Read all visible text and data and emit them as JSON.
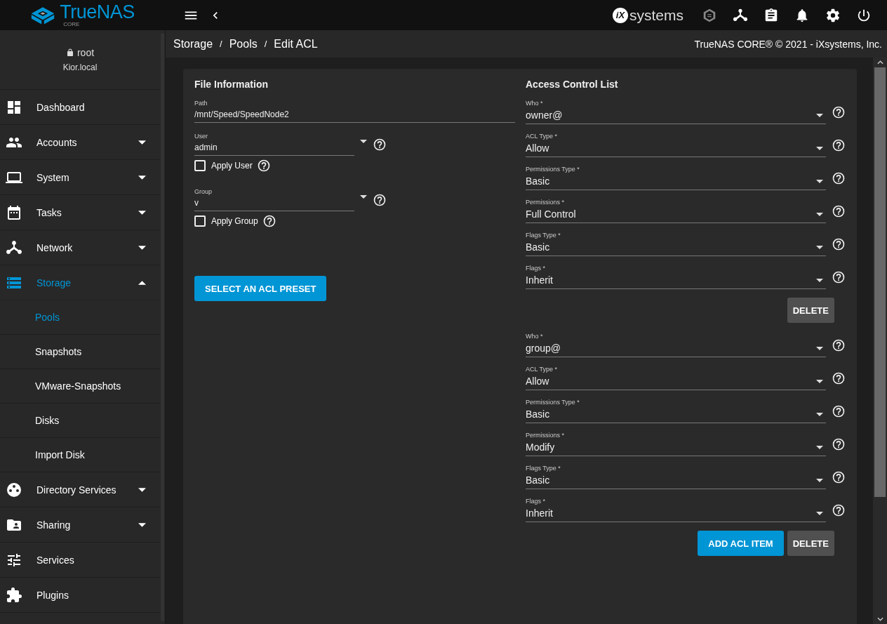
{
  "topbar": {
    "logo_text": "TrueNAS",
    "logo_sub": "CORE",
    "vendor_mark": "iX",
    "vendor_text": "systems"
  },
  "sidebar": {
    "user": "root",
    "host": "Kior.local",
    "items": [
      {
        "label": "Dashboard",
        "expandable": false,
        "selected": false
      },
      {
        "label": "Accounts",
        "expandable": true,
        "expanded": false,
        "selected": false
      },
      {
        "label": "System",
        "expandable": true,
        "expanded": false,
        "selected": false
      },
      {
        "label": "Tasks",
        "expandable": true,
        "expanded": false,
        "selected": false
      },
      {
        "label": "Network",
        "expandable": true,
        "expanded": false,
        "selected": false
      },
      {
        "label": "Storage",
        "expandable": true,
        "expanded": true,
        "selected": true,
        "children": [
          {
            "label": "Pools",
            "selected": true
          },
          {
            "label": "Snapshots",
            "selected": false
          },
          {
            "label": "VMware-Snapshots",
            "selected": false
          },
          {
            "label": "Disks",
            "selected": false
          },
          {
            "label": "Import Disk",
            "selected": false
          }
        ]
      },
      {
        "label": "Directory Services",
        "expandable": true,
        "expanded": false,
        "selected": false
      },
      {
        "label": "Sharing",
        "expandable": true,
        "expanded": false,
        "selected": false
      },
      {
        "label": "Services",
        "expandable": false,
        "selected": false
      },
      {
        "label": "Plugins",
        "expandable": false,
        "selected": false
      }
    ]
  },
  "breadcrumb": {
    "items": [
      "Storage",
      "Pools",
      "Edit ACL"
    ],
    "separators": [
      "/",
      "/"
    ]
  },
  "copyright": "TrueNAS CORE® © 2021 - iXsystems, Inc.",
  "file_info": {
    "title": "File Information",
    "path": {
      "label": "Path",
      "value": "/mnt/Speed/SpeedNode2"
    },
    "user": {
      "label": "User",
      "value": "admin"
    },
    "apply_user": {
      "label": "Apply User",
      "checked": false
    },
    "group": {
      "label": "Group",
      "value": "v"
    },
    "apply_group": {
      "label": "Apply Group",
      "checked": false
    },
    "preset_button": "SELECT AN ACL PRESET"
  },
  "acl": {
    "title": "Access Control List",
    "entries": [
      {
        "fields": [
          {
            "label": "Who *",
            "value": "owner@"
          },
          {
            "label": "ACL Type *",
            "value": "Allow"
          },
          {
            "label": "Permissions Type *",
            "value": "Basic"
          },
          {
            "label": "Permissions *",
            "value": "Full Control"
          },
          {
            "label": "Flags Type *",
            "value": "Basic"
          },
          {
            "label": "Flags *",
            "value": "Inherit"
          }
        ],
        "delete_button": "DELETE"
      },
      {
        "fields": [
          {
            "label": "Who *",
            "value": "group@"
          },
          {
            "label": "ACL Type *",
            "value": "Allow"
          },
          {
            "label": "Permissions Type *",
            "value": "Basic"
          },
          {
            "label": "Permissions *",
            "value": "Modify"
          },
          {
            "label": "Flags Type *",
            "value": "Basic"
          },
          {
            "label": "Flags *",
            "value": "Inherit"
          }
        ],
        "delete_button": "DELETE"
      }
    ],
    "add_button": "ADD ACL ITEM"
  }
}
